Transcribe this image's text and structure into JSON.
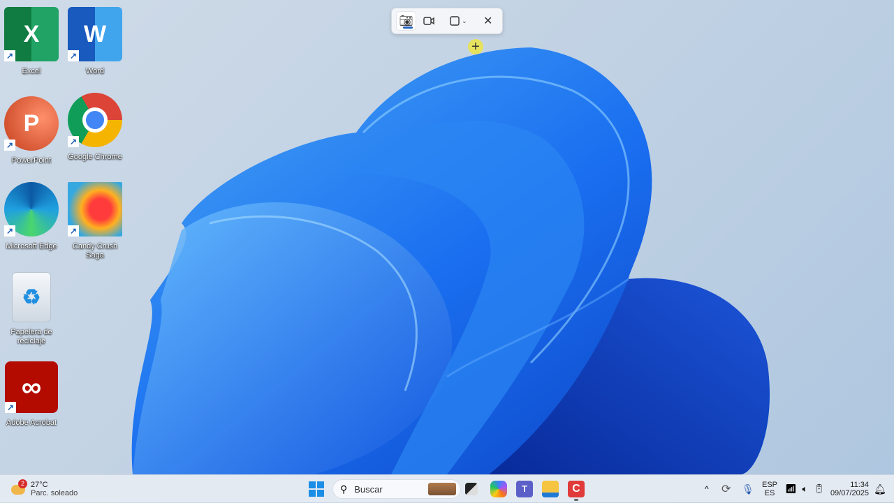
{
  "desktop": {
    "icons": [
      {
        "label": "Excel",
        "letter": "X",
        "color": "#1d7044"
      },
      {
        "label": "Word",
        "letter": "W",
        "color": "#2b5fc0"
      },
      {
        "label": "PowerPoint",
        "letter": "P",
        "color": "#d04a2b"
      },
      {
        "label": "Google Chrome"
      },
      {
        "label": "Microsoft Edge"
      },
      {
        "label": "Candy Crush Saga"
      },
      {
        "label": "Papelera de reciclaje"
      },
      {
        "label": "Adobe Acrobat"
      }
    ]
  },
  "snipping_toolbar": {
    "tools": [
      "camera-icon",
      "video-icon",
      "snip-mode-icon",
      "close-icon"
    ]
  },
  "taskbar": {
    "weather": {
      "badge": "2",
      "temp": "27°C",
      "condition": "Parc. soleado"
    },
    "search_placeholder": "Buscar",
    "tray": {
      "lang_top": "ESP",
      "lang_bottom": "ES",
      "time": "11:34",
      "date": "09/07/2025"
    }
  }
}
